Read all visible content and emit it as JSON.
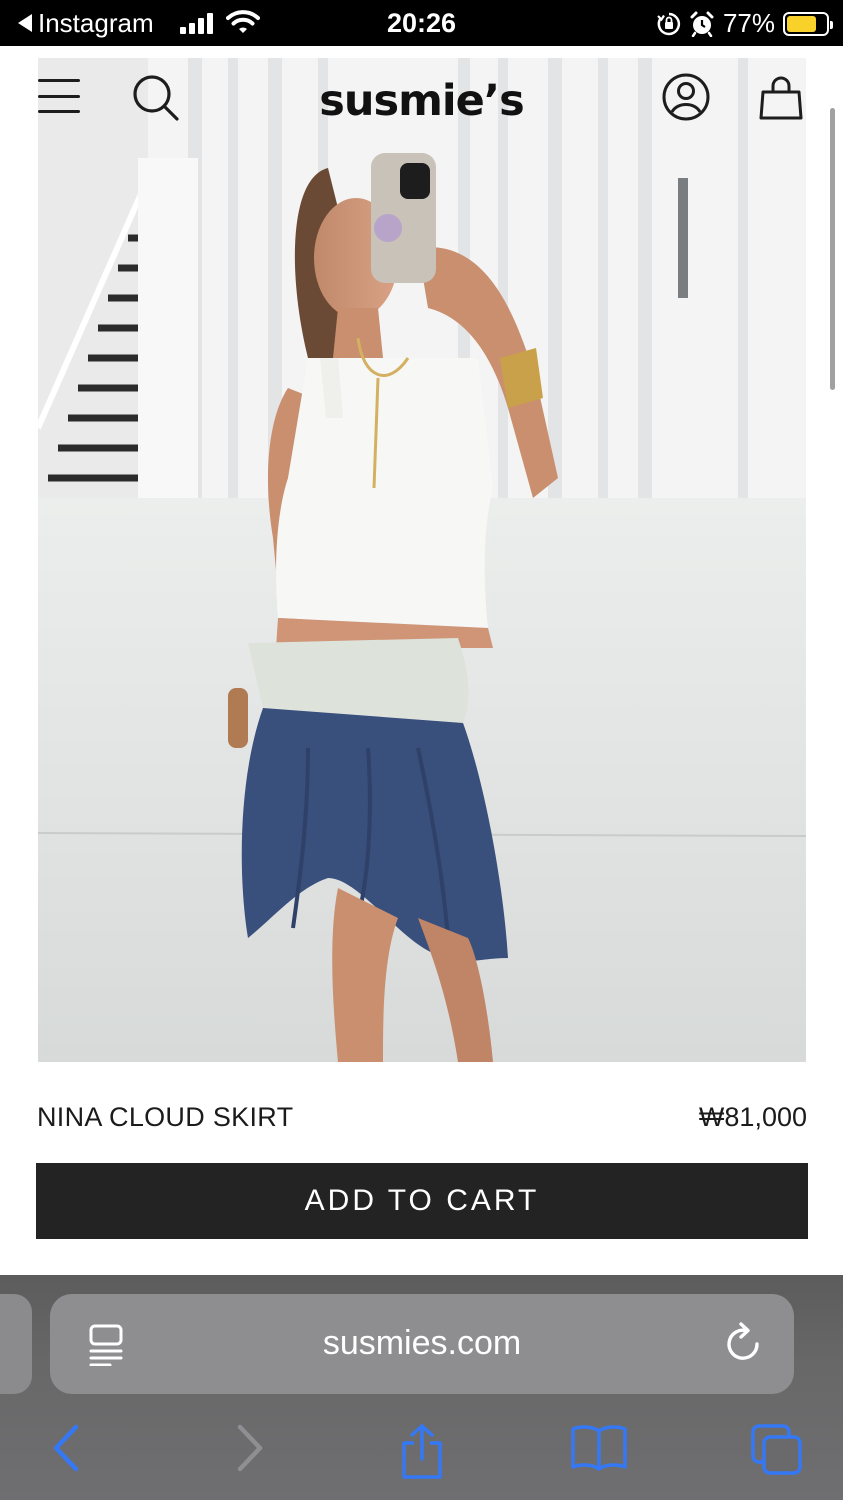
{
  "status_bar": {
    "back_app": "Instagram",
    "time": "20:26",
    "battery_percent": "77%",
    "battery_level": 0.77,
    "battery_color": "#f8d12b"
  },
  "site": {
    "logo": "susmie’s",
    "icons": [
      "menu-icon",
      "search-icon",
      "account-icon",
      "shopping-bag-icon"
    ]
  },
  "product": {
    "name": "NINA CLOUD SKIRT",
    "price": "₩81,000",
    "cta_label": "ADD TO CART",
    "cta_color": "#232323"
  },
  "browser": {
    "url": "susmies.com",
    "icons": [
      "reader-icon",
      "reload-icon",
      "back-icon",
      "forward-icon",
      "share-icon",
      "bookmarks-icon",
      "tabs-icon"
    ],
    "accent": "#3478f6"
  }
}
